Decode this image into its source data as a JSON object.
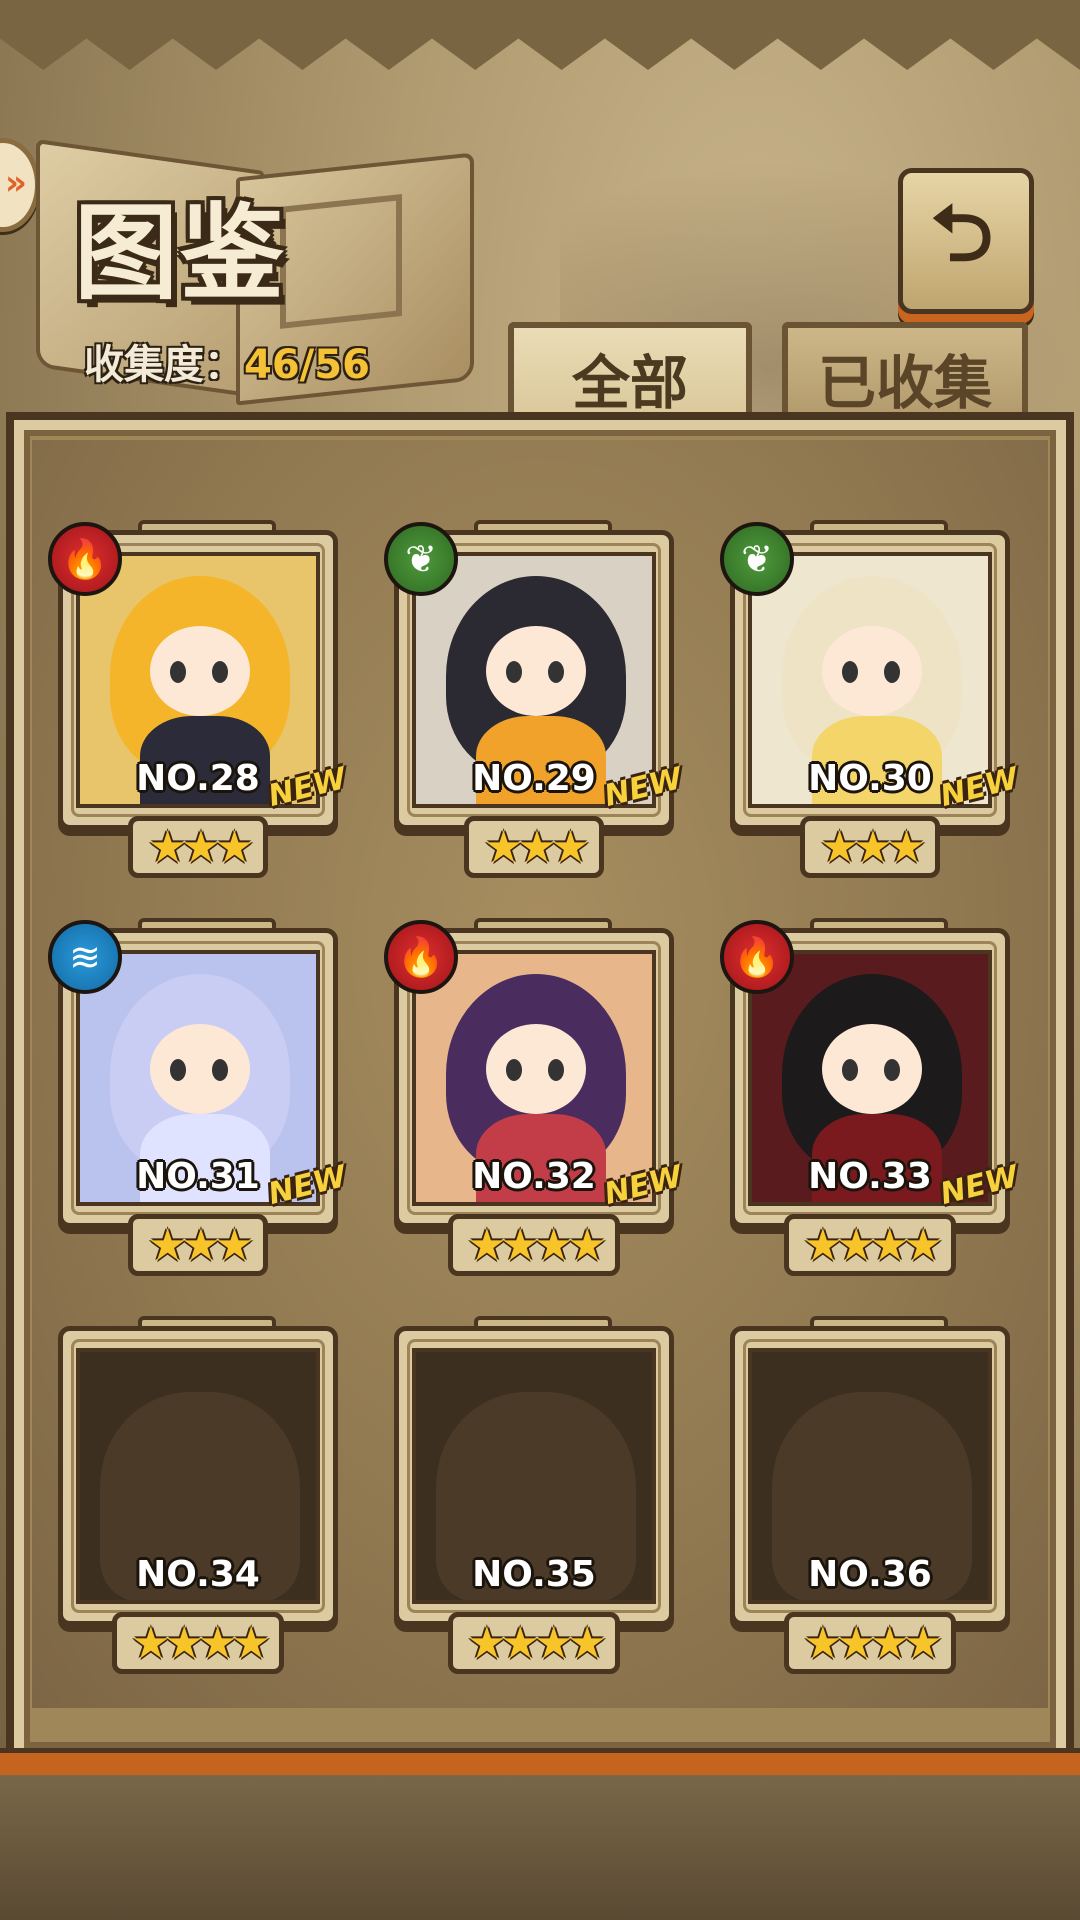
{
  "header": {
    "title": "图鉴",
    "collection_label": "收集度：",
    "collection_count": "46/56"
  },
  "tabs": [
    {
      "label": "全部",
      "active": true
    },
    {
      "label": "已收集",
      "active": false
    }
  ],
  "back_button": {
    "icon": "return-arrow-icon",
    "glyph": "⮌"
  },
  "colors": {
    "accent_orange": "#c9651f",
    "star_gold": "#f7c52a",
    "fire": "#d22a2a",
    "leaf": "#3f8a30",
    "water": "#1f86c9"
  },
  "cards": [
    {
      "number": "NO.28",
      "element": "fire",
      "element_icon": "🔥",
      "stars": 3,
      "star_text": "★★★",
      "is_new": true,
      "new_label": "NEW",
      "collected": true
    },
    {
      "number": "NO.29",
      "element": "leaf",
      "element_icon": "❦",
      "stars": 3,
      "star_text": "★★★",
      "is_new": true,
      "new_label": "NEW",
      "collected": true
    },
    {
      "number": "NO.30",
      "element": "leaf",
      "element_icon": "❦",
      "stars": 3,
      "star_text": "★★★",
      "is_new": true,
      "new_label": "NEW",
      "collected": true
    },
    {
      "number": "NO.31",
      "element": "water",
      "element_icon": "≋",
      "stars": 3,
      "star_text": "★★★",
      "is_new": true,
      "new_label": "NEW",
      "collected": true
    },
    {
      "number": "NO.32",
      "element": "fire",
      "element_icon": "🔥",
      "stars": 4,
      "star_text": "★★★★",
      "is_new": true,
      "new_label": "NEW",
      "collected": true
    },
    {
      "number": "NO.33",
      "element": "fire",
      "element_icon": "🔥",
      "stars": 4,
      "star_text": "★★★★",
      "is_new": true,
      "new_label": "NEW",
      "collected": true
    },
    {
      "number": "NO.34",
      "element": null,
      "stars": 4,
      "star_text": "★★★★",
      "is_new": false,
      "collected": false
    },
    {
      "number": "NO.35",
      "element": null,
      "stars": 4,
      "star_text": "★★★★",
      "is_new": false,
      "collected": false
    },
    {
      "number": "NO.36",
      "element": null,
      "stars": 4,
      "star_text": "★★★★",
      "is_new": false,
      "collected": false
    }
  ]
}
